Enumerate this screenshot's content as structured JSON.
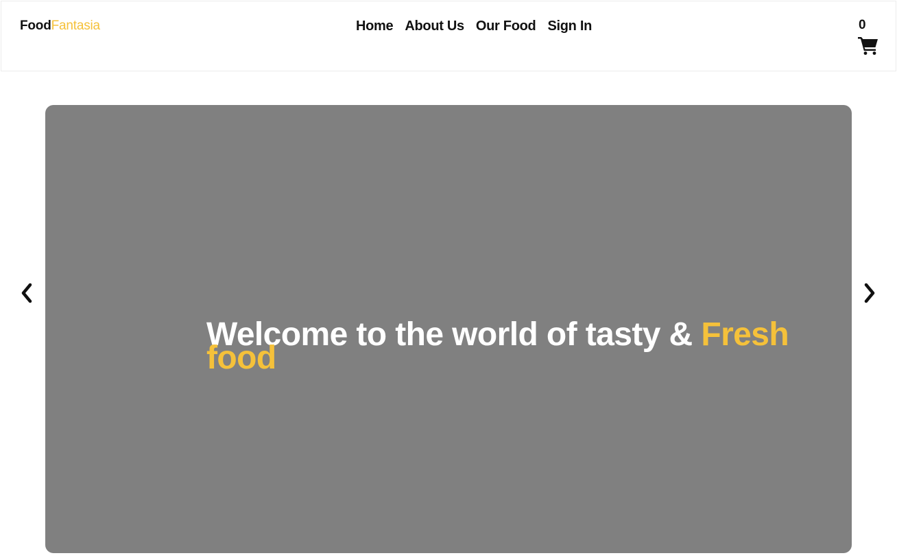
{
  "brand": {
    "name_part1": "Food",
    "name_part2": "Fantasia",
    "accent_color": "#f5c13a"
  },
  "nav": {
    "items": [
      {
        "label": "Home"
      },
      {
        "label": "About Us"
      },
      {
        "label": "Our Food"
      },
      {
        "label": "Sign In"
      }
    ]
  },
  "cart": {
    "count": "0",
    "icon": "shopping-cart-icon"
  },
  "carousel": {
    "prev_icon": "chevron-left-icon",
    "next_icon": "chevron-right-icon",
    "background_color": "#808080",
    "slide": {
      "headline": "Welcome to the world of tasty & ",
      "headline_highlight": "Fresh food"
    }
  }
}
